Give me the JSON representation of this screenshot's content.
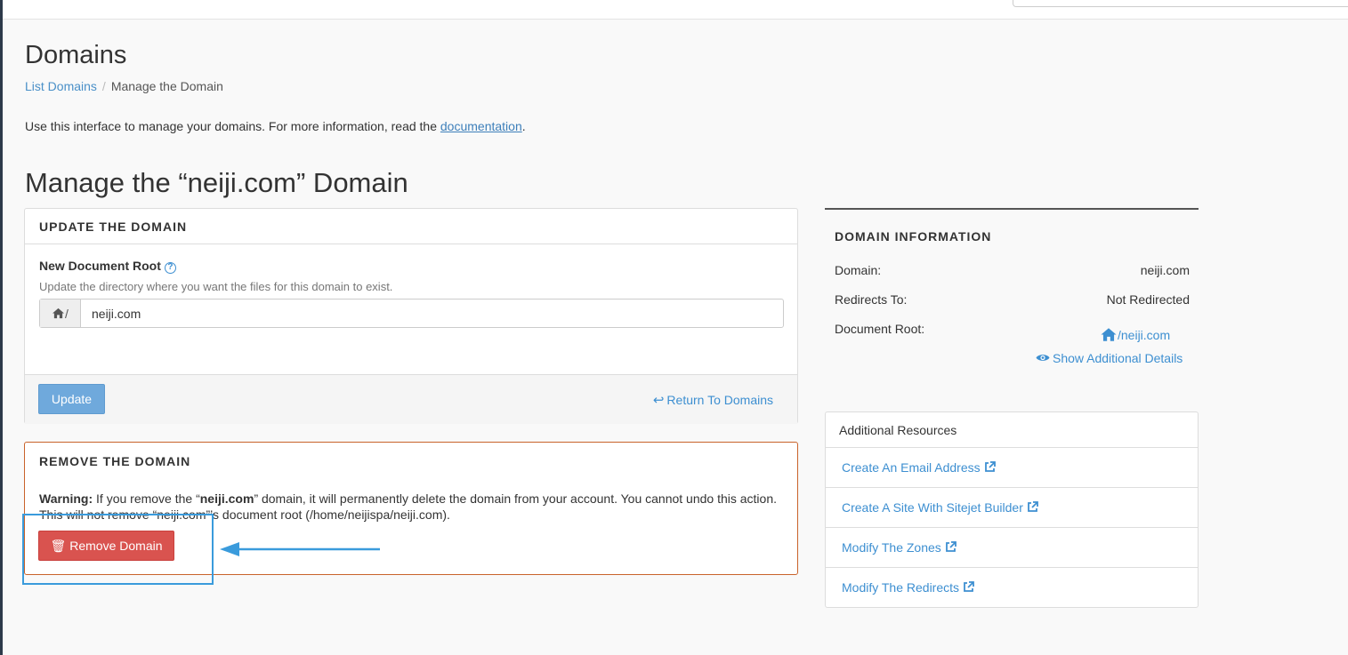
{
  "page": {
    "title": "Domains",
    "breadcrumb": {
      "parent": "List Domains",
      "current": "Manage the Domain"
    },
    "intro_text": "Use this interface to manage your domains. For more information, read the ",
    "intro_link": "documentation",
    "intro_end": ".",
    "manage_title": "Manage the “neiji.com” Domain"
  },
  "update_panel": {
    "heading": "UPDATE THE DOMAIN",
    "field_label": "New Document Root",
    "help_icon": "?",
    "field_help": "Update the directory where you want the files for this domain to exist.",
    "addon_text": "/",
    "input_value": "neiji.com",
    "update_label": "Update",
    "return_label": "Return To Domains"
  },
  "remove_panel": {
    "heading": "REMOVE THE DOMAIN",
    "warning_label": "Warning:",
    "warning_part1": " If you remove the “",
    "warning_domain": "neiji.com",
    "warning_part2": "” domain, it will permanently delete the domain from your account. You cannot undo this action. This will not remove “neiji.com”’s document root (/home/neijispa/neiji.com).",
    "remove_label": "Remove Domain",
    "trash_icon": "🗑"
  },
  "domain_info": {
    "heading": "DOMAIN INFORMATION",
    "domain_label": "Domain:",
    "domain_value": "neiji.com",
    "redirects_label": "Redirects To:",
    "redirects_value": "Not Redirected",
    "docroot_label": "Document Root:",
    "docroot_value": "/neiji.com",
    "details_label": "Show Additional Details"
  },
  "resources": {
    "heading": "Additional Resources",
    "items": [
      {
        "label": "Create An Email Address"
      },
      {
        "label": "Create A Site With Sitejet Builder"
      },
      {
        "label": "Modify The Zones"
      },
      {
        "label": "Modify The Redirects"
      }
    ]
  },
  "colors": {
    "link": "#3d8fd1",
    "danger": "#d9534f",
    "primary_disabled": "#6fa9dc",
    "annotation": "#3a9bdc"
  }
}
